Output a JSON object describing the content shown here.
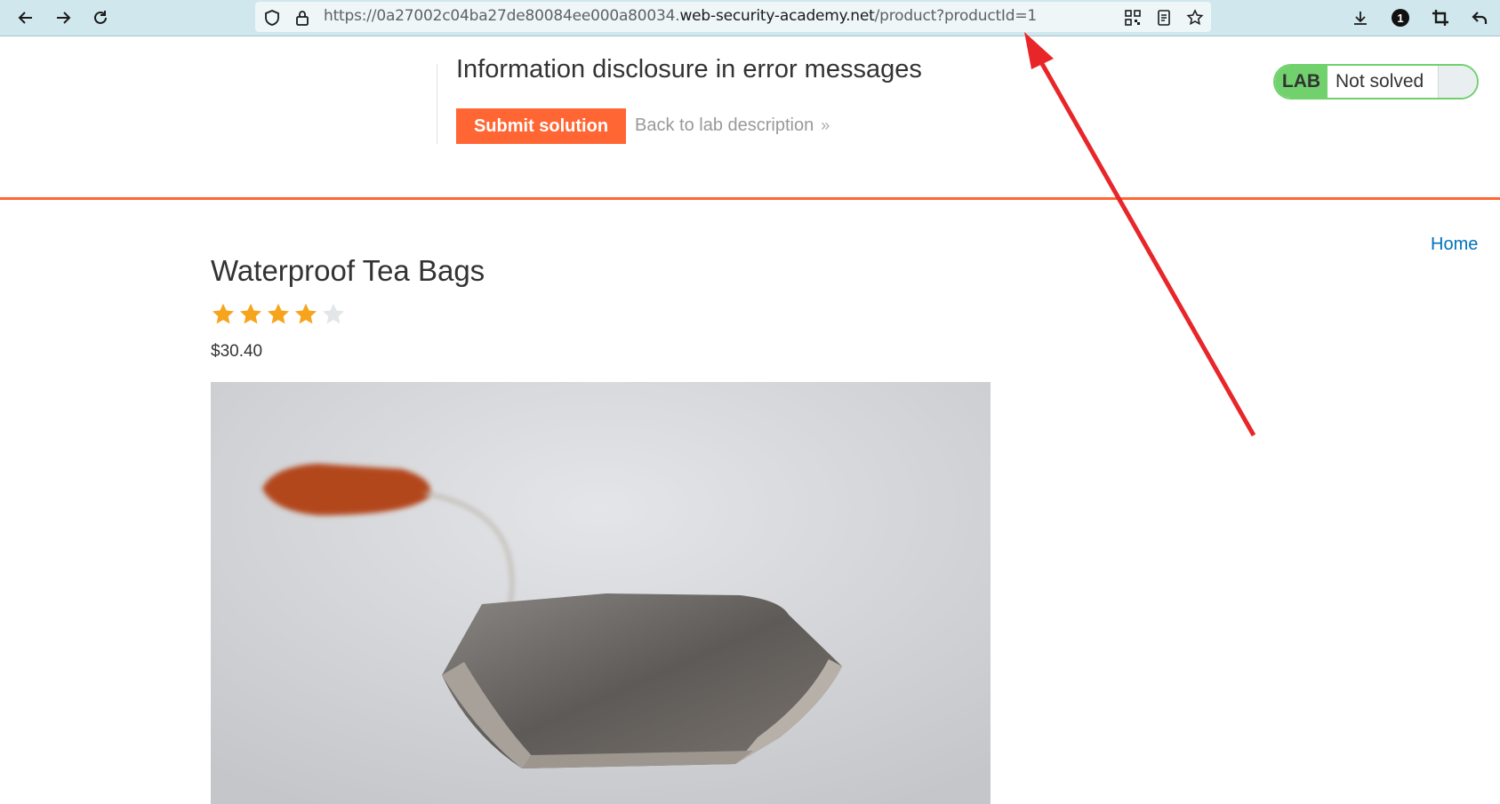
{
  "browser": {
    "url_prefix": "https://0a27002c04ba27de80084ee000a80034.",
    "url_host": "web-security-academy.net",
    "url_path": "/product?productId=1",
    "icons": [
      "back-icon",
      "forward-icon",
      "reload-icon",
      "shield-icon",
      "lock-icon",
      "qr-code-icon",
      "reader-icon",
      "bookmark-star-icon",
      "download-icon",
      "extension-1-icon",
      "crop-icon",
      "undo-icon"
    ]
  },
  "lab": {
    "title": "Information disclosure in error messages",
    "submit_label": "Submit solution",
    "back_label": "Back to lab description",
    "badge_label": "LAB",
    "status_label": "Not solved",
    "accent_color": "#ff6633",
    "badge_color": "#70d16d"
  },
  "nav": {
    "home_label": "Home"
  },
  "product": {
    "name": "Waterproof Tea Bags",
    "rating": 4,
    "rating_max": 5,
    "price": "$30.40",
    "image_subject": "tea-bag-photo"
  },
  "annotation": {
    "arrow_color": "#e8262a"
  }
}
